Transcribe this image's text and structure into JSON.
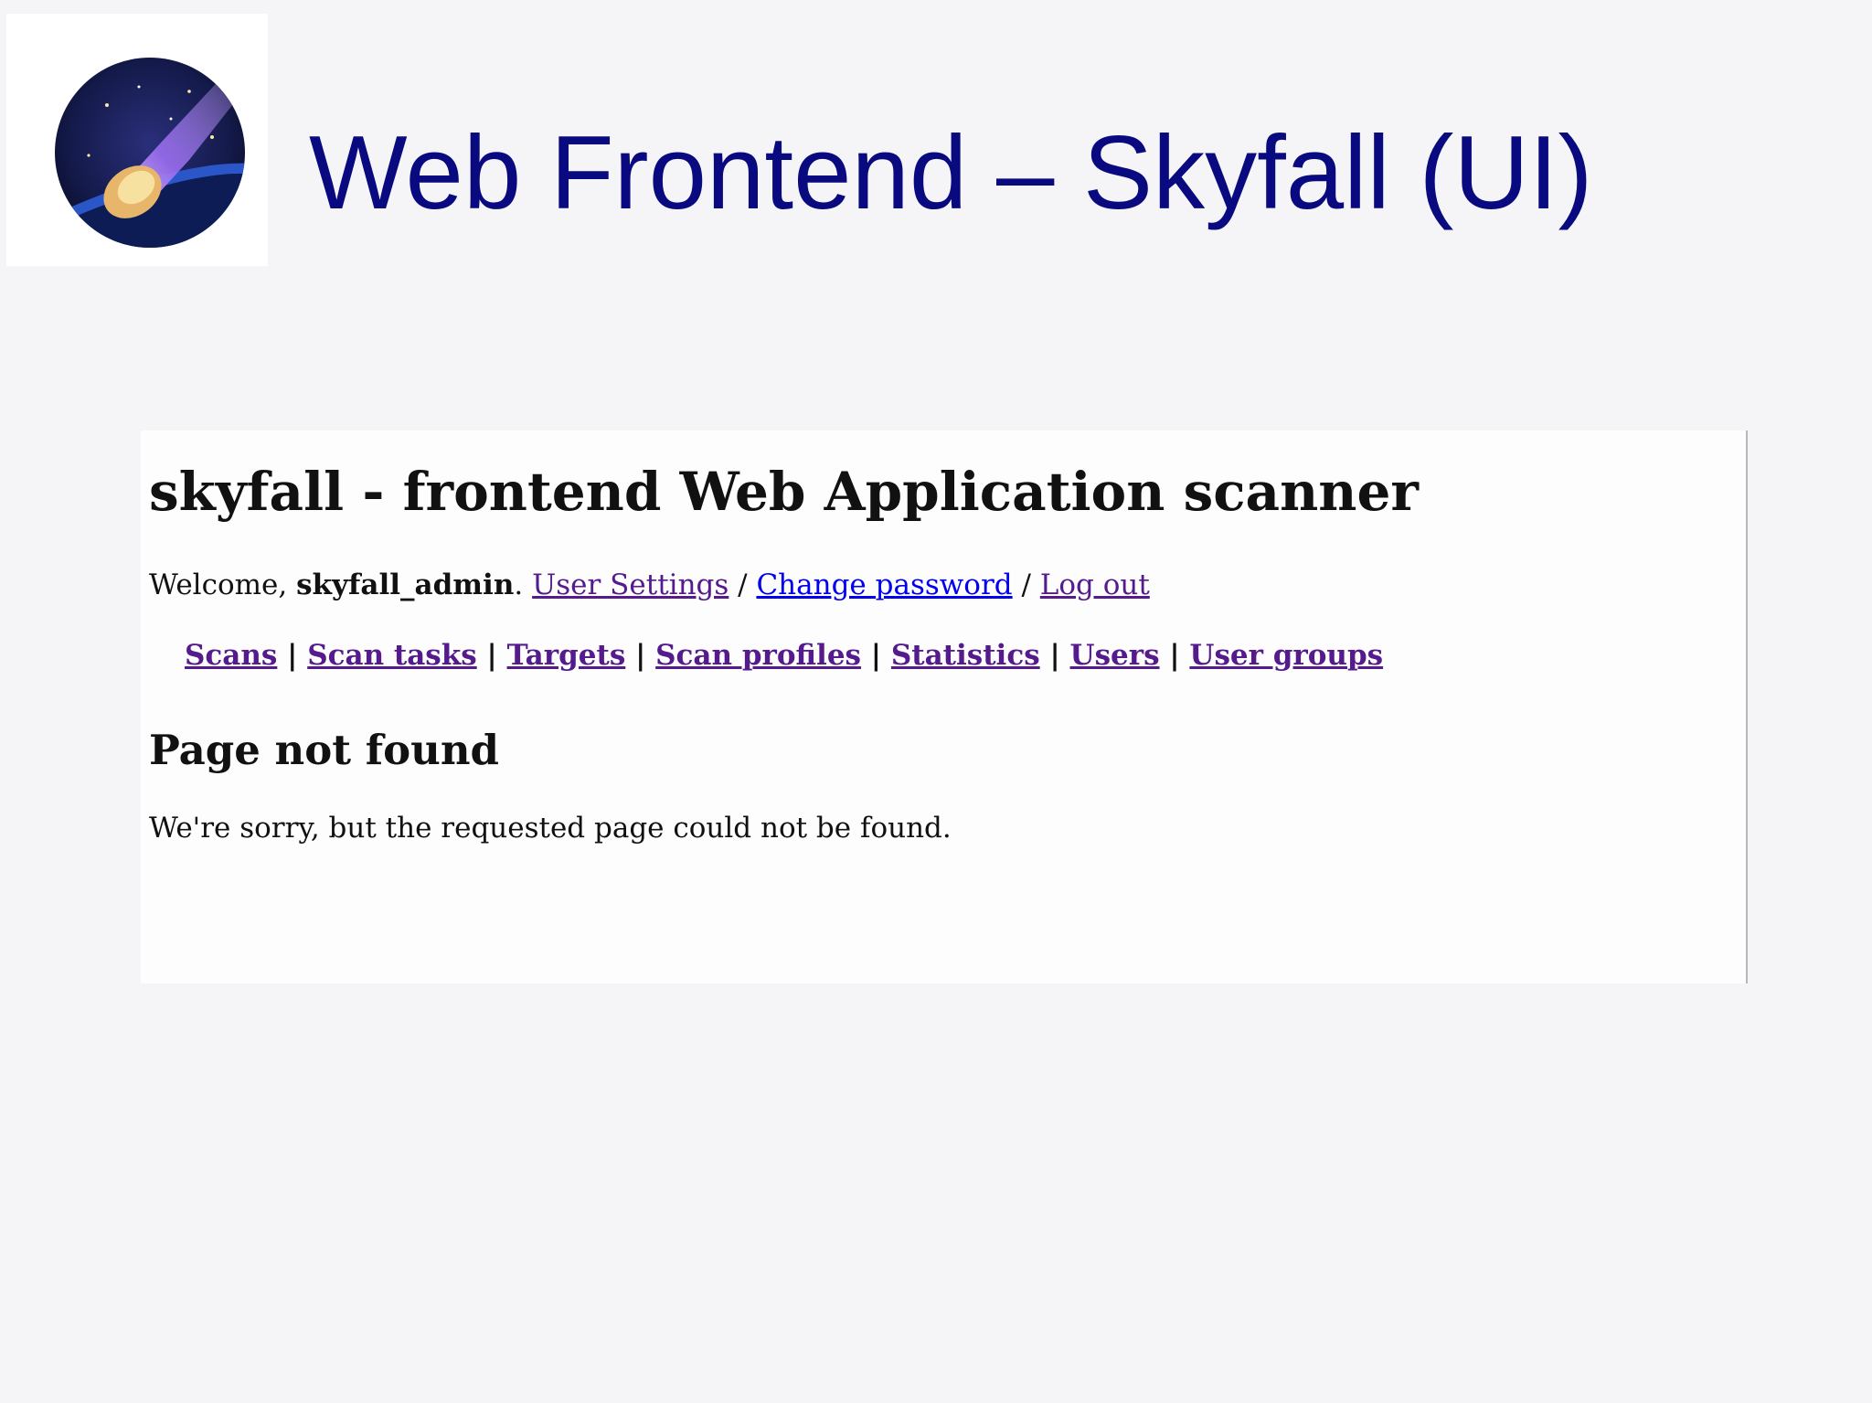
{
  "slide": {
    "title": "Web Frontend – Skyfall (UI)",
    "logo_icon": "meteor-icon"
  },
  "app": {
    "heading": "skyfall - frontend Web Application scanner",
    "welcome_prefix": "Welcome, ",
    "username": "skyfall_admin",
    "welcome_suffix": ". ",
    "user_links": {
      "user_settings": "User Settings",
      "change_password": "Change password",
      "log_out": "Log out",
      "separator": " / "
    },
    "nav": {
      "items": [
        "Scans",
        "Scan tasks",
        "Targets",
        "Scan profiles",
        "Statistics",
        "Users",
        "User groups"
      ],
      "separator": " | "
    },
    "error_title": "Page not found",
    "error_message": "We're sorry, but the requested page could not be found."
  },
  "colors": {
    "title": "#0a0a80",
    "visited_link": "#551a8b",
    "link": "#0000ee",
    "background": "#f5f5f7"
  }
}
